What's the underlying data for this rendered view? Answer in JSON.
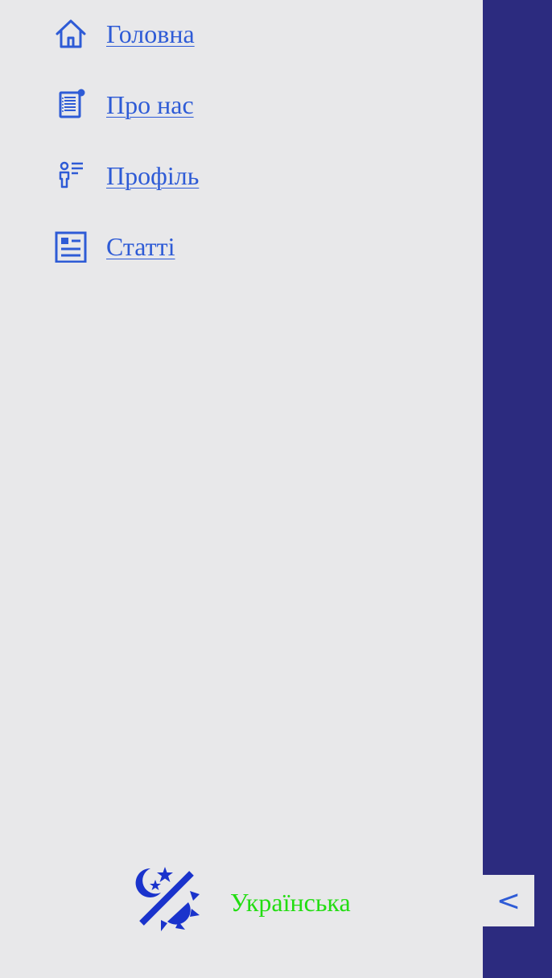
{
  "nav": {
    "items": [
      {
        "label": "Головна",
        "icon": "home-icon"
      },
      {
        "label": "Про нас",
        "icon": "document-icon"
      },
      {
        "label": "Профіль",
        "icon": "profile-icon"
      },
      {
        "label": "Статті",
        "icon": "articles-icon"
      }
    ]
  },
  "footer": {
    "theme_icon": "theme-toggle-icon",
    "language_label": "Українська"
  },
  "collapse": {
    "label": "<"
  },
  "colors": {
    "background": "#E8E8EA",
    "strip": "#2C2B7F",
    "link": "#2E5BD6",
    "language": "#22DD11",
    "theme_icon": "#1A33CC"
  }
}
